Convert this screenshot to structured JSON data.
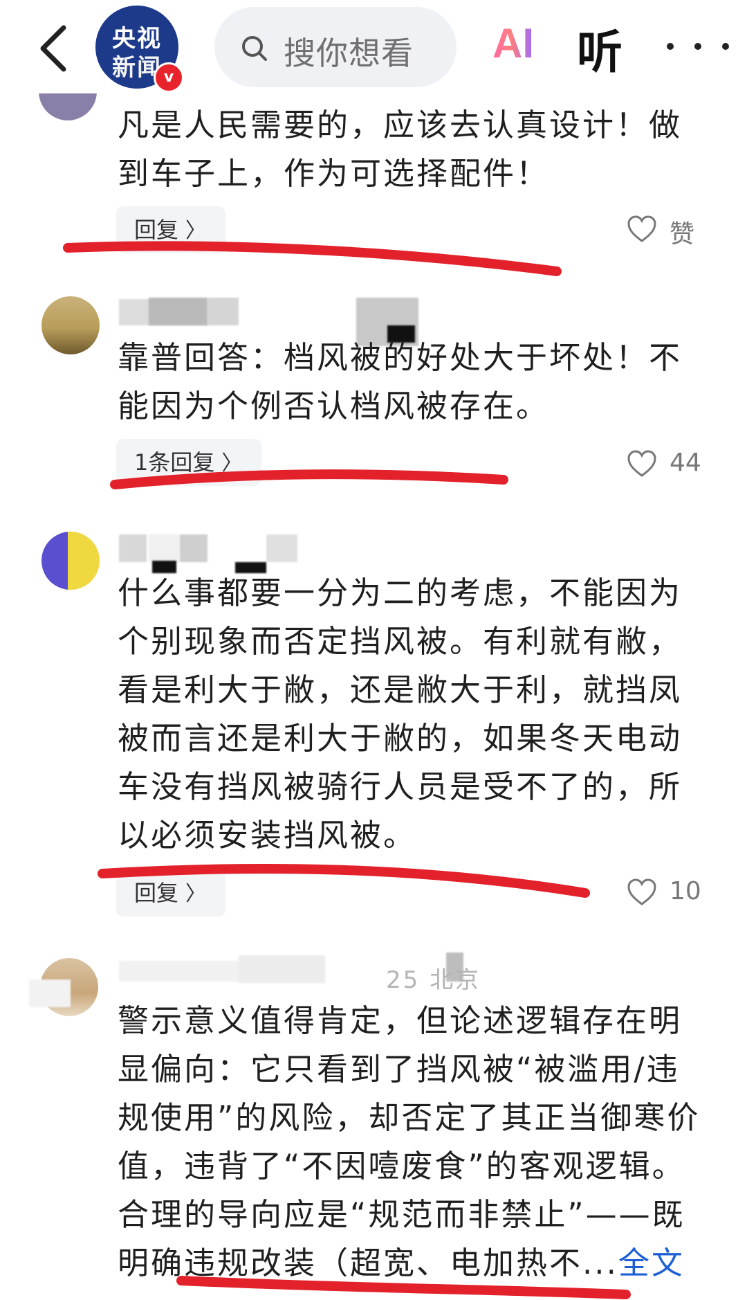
{
  "header": {
    "logo_line1": "央视",
    "logo_line2": "新闻",
    "verified_badge": "v",
    "search_placeholder": "搜你想看",
    "ai_label": "AI",
    "listen_label": "听"
  },
  "colors": {
    "accent_red": "#e8232c",
    "link_blue": "#1f5fd6",
    "logo_blue": "#1d3a8a"
  },
  "comments": [
    {
      "text_lines": [
        "凡是人民需要的，应该去认真设计！做",
        "到车子上，作为可选择配件！"
      ],
      "reply_label": "回复",
      "like_label": "赞"
    },
    {
      "text_lines": [
        "靠普回答：档风被的好处大于坏处！不",
        "能因为个例否认档风被存在。"
      ],
      "reply_label": "1条回复",
      "like_label": "44"
    },
    {
      "text_lines": [
        "什么事都要一分为二的考虑，不能因为",
        "个别现象而否定挡风被。有利就有敝，",
        "看是利大于敝，还是敝大于利，就挡凤",
        "被而言还是利大于敝的，如果冬天电动",
        "车没有挡风被骑行人员是受不了的，所",
        "以必须安装挡风被。"
      ],
      "reply_label": "回复",
      "like_label": "10"
    },
    {
      "meta_partial": "25 北京",
      "text_lines": [
        "警示意义值得肯定，但论述逻辑存在明",
        "显偏向：它只看到了挡风被“被滥用/违",
        "规使用”的风险，却否定了其正当御寒价",
        "值，违背了“不因噎废食”的客观逻辑。",
        "合理的导向应是“规范而非禁止”——既",
        "明确违规改装（超宽、电加热不..."
      ],
      "full_text_link": "全文"
    }
  ]
}
